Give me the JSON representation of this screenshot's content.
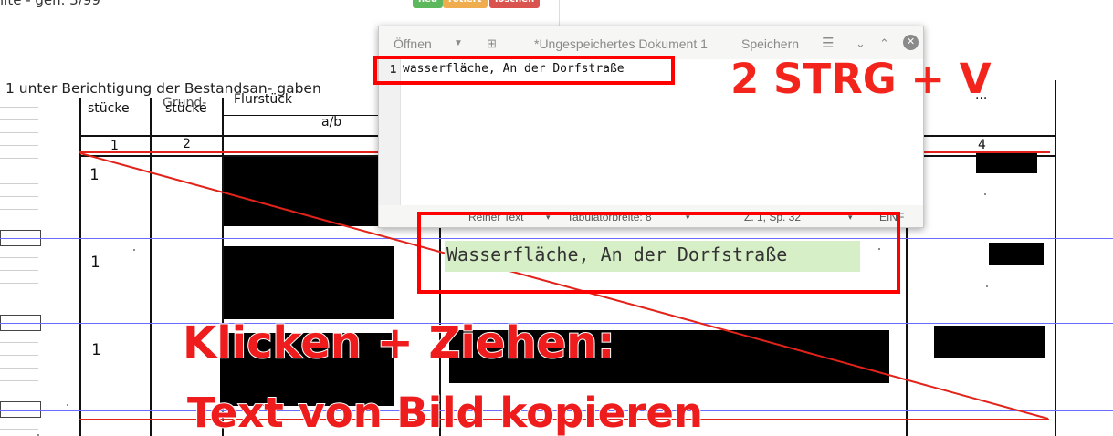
{
  "top": {
    "clipped_text": "lite - gen. 3/99",
    "chips": [
      {
        "label": "neu",
        "color": "#5cb85c"
      },
      {
        "label": "rotiert",
        "color": "#f0ad4e"
      },
      {
        "label": "löschen",
        "color": "#d9534f"
      }
    ]
  },
  "document": {
    "caption": "1 unter Berichtigung der Bestandsan- gaben",
    "headers": {
      "col1": "stücke",
      "col2_top": "Grund-",
      "col2": "stücke",
      "col3": "Flurstück",
      "col3_sub": "a/b",
      "col4_partial": "..."
    },
    "column_numbers": [
      "1",
      "2",
      "4"
    ],
    "row_numbers": [
      "1",
      "1",
      "1"
    ],
    "ocr_text": "Wasserfläche, An der Dorfstraße"
  },
  "editor": {
    "open_label": "Öffnen",
    "title": "*Ungespeichertes Dokument 1",
    "save_label": "Speichern",
    "menu_icon": "hamburger-menu-icon",
    "line_number": "1",
    "line_text": "wasserfläche, An der Dorfstraße",
    "status": {
      "syntax": "Reiner Text",
      "tab_width": "Tabulatorbreite: 8",
      "position": "Z. 1, Sp. 32",
      "insert_mode": "EINF"
    }
  },
  "annotations": {
    "step2": "2 STRG + V",
    "step1_line1": "Klicken + Ziehen:",
    "step1_line2": "Text von Bild kopieren"
  },
  "colors": {
    "annotation_red": "#f2241c",
    "highlight_green": "#d7efc6",
    "grid_blue": "#6b6bff"
  }
}
